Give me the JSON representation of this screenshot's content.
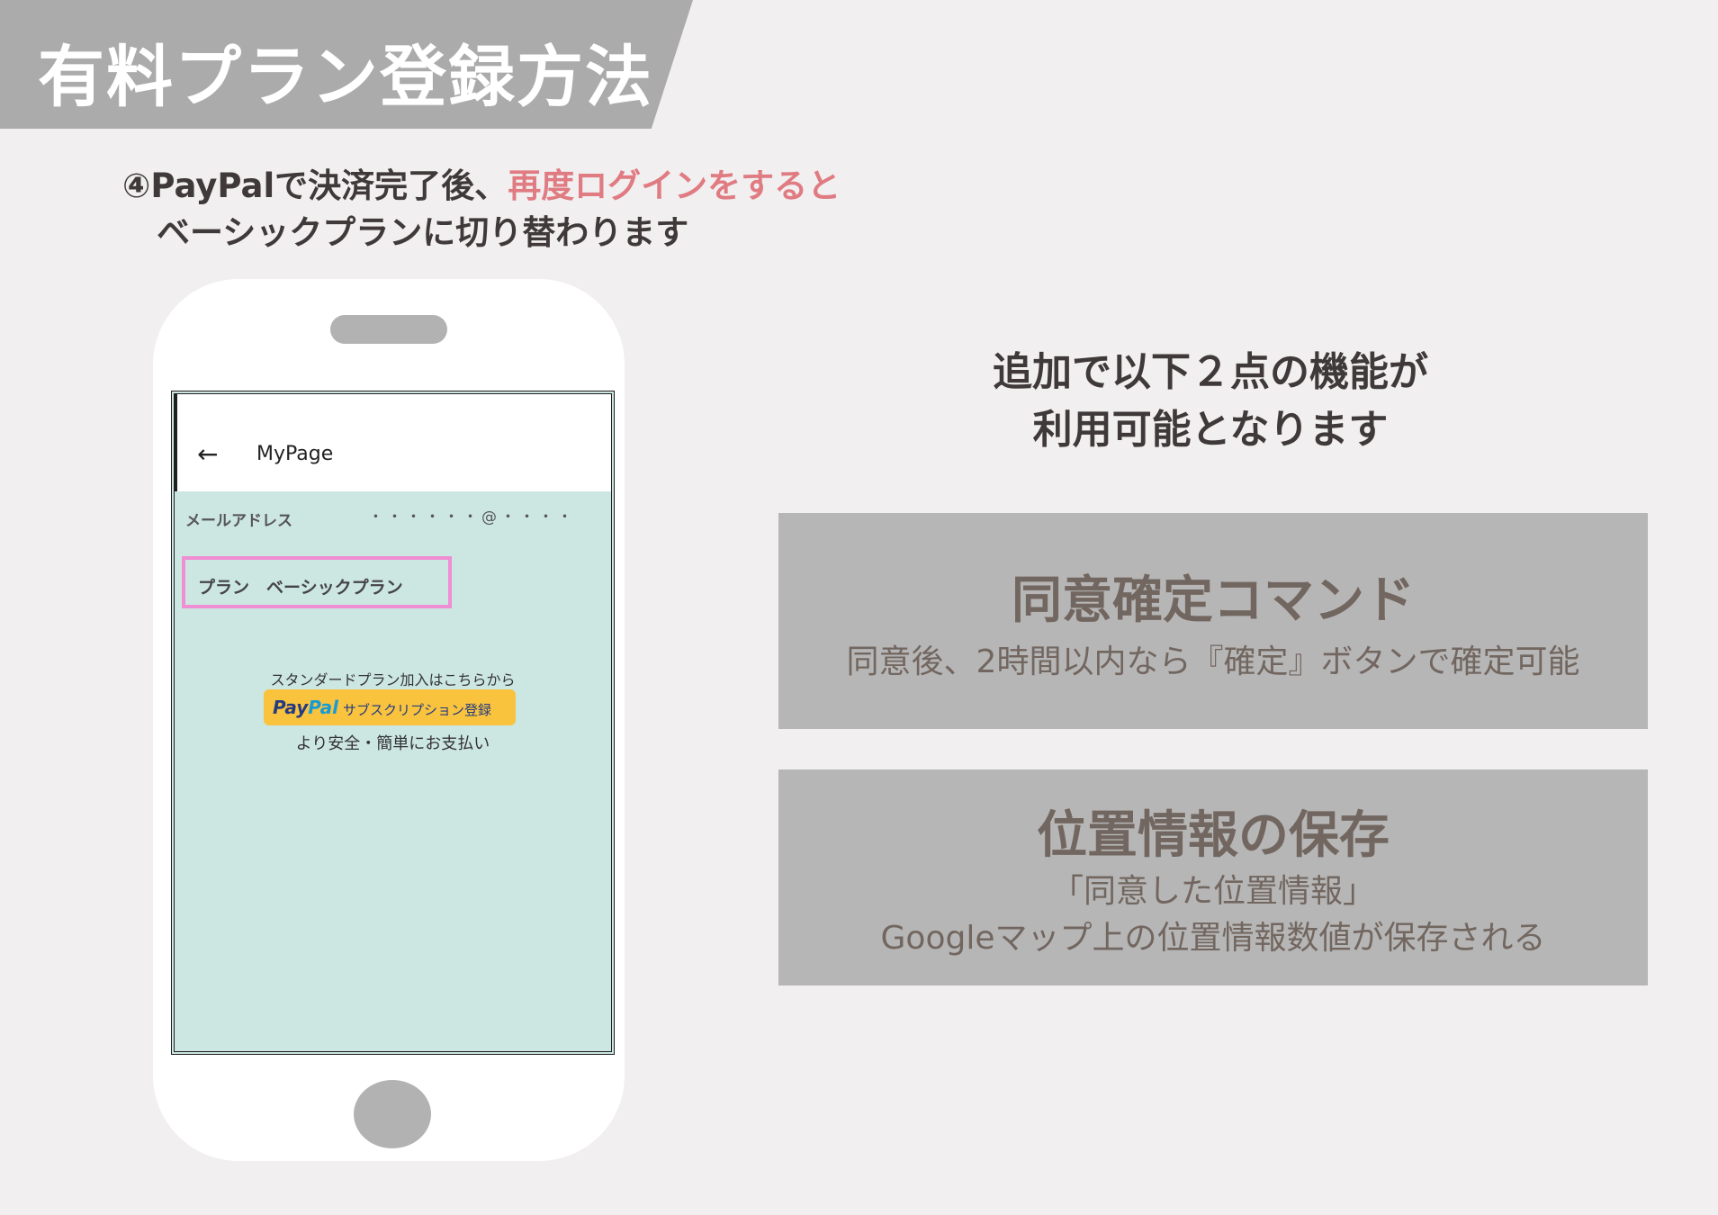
{
  "title": "有料プラン登録方法",
  "step": {
    "line1_prefix": "④PayPalで決済完了後、",
    "line1_highlight": "再度ログインをすると",
    "line2": "ベーシックプランに切り替わります"
  },
  "phone": {
    "header_title": "MyPage",
    "back_arrow": "←",
    "email_label": "メールアドレス",
    "email_value": "・・・・・・@・・・・",
    "plan_text": "プラン　ベーシックプラン",
    "standard_text": "スタンダードプラン加入はこちらから",
    "paypal_logo_1": "Pay",
    "paypal_logo_2": "Pal",
    "paypal_subscription": "サブスクリプション登録",
    "safe_text": "より安全・簡単にお支払い"
  },
  "features": {
    "intro_line1": "追加で以下２点の機能が",
    "intro_line2": "利用可能となります",
    "card1": {
      "title": "同意確定コマンド",
      "desc": "同意後、2時間以内なら『確定』ボタンで確定可能"
    },
    "card2": {
      "title": "位置情報の保存",
      "desc_line1": "「同意した位置情報」",
      "desc_line2": "Googleマップ上の位置情報数値が保存される"
    }
  }
}
